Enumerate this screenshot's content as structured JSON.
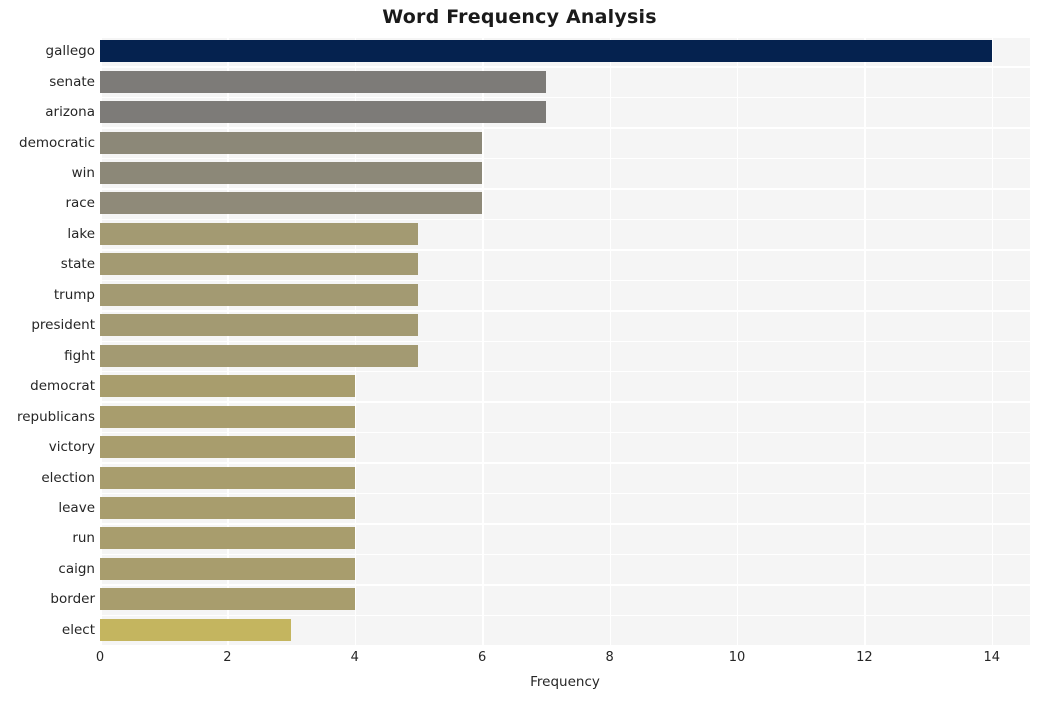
{
  "chart_data": {
    "type": "bar",
    "orientation": "horizontal",
    "title": "Word Frequency Analysis",
    "xlabel": "Frequency",
    "ylabel": "",
    "categories": [
      "gallego",
      "senate",
      "arizona",
      "democratic",
      "win",
      "race",
      "lake",
      "state",
      "trump",
      "president",
      "fight",
      "democrat",
      "republicans",
      "victory",
      "election",
      "leave",
      "run",
      "caign",
      "border",
      "elect"
    ],
    "values": [
      14,
      7,
      7,
      6,
      6,
      6,
      5,
      5,
      5,
      5,
      5,
      4,
      4,
      4,
      4,
      4,
      4,
      4,
      4,
      3
    ],
    "bar_colors": [
      "#05224f",
      "#7d7b78",
      "#7d7b78",
      "#8c8878",
      "#8c8878",
      "#8f8a79",
      "#a39a72",
      "#a39a72",
      "#a39a72",
      "#a39a72",
      "#a39a72",
      "#a89d6d",
      "#a89d6d",
      "#a89d6d",
      "#a89d6d",
      "#a89d6d",
      "#a89d6d",
      "#a89d6d",
      "#a89d6d",
      "#c4b55f"
    ],
    "xlim": [
      0,
      14.6
    ],
    "xticks": [
      0,
      2,
      4,
      6,
      8,
      10,
      12,
      14
    ],
    "xtick_labels": [
      "0",
      "2",
      "4",
      "6",
      "8",
      "10",
      "12",
      "14"
    ],
    "grid": true,
    "grid_color": "#ffffff",
    "plot_background": "#f5f5f5",
    "figure_background": "#ffffff",
    "legend": null
  }
}
